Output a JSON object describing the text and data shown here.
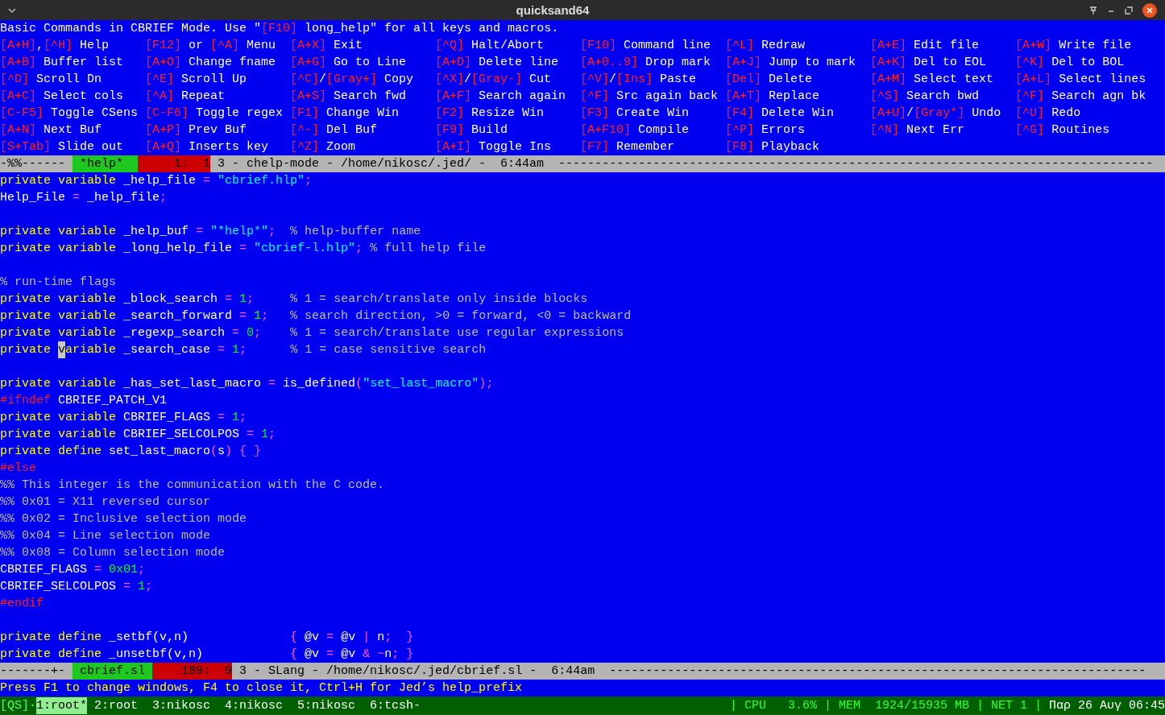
{
  "window": {
    "title": "quicksand64"
  },
  "help": {
    "header": [
      {
        "kind": "text",
        "text": "Basic Commands in CBRIEF Mode. Use \""
      },
      {
        "kind": "key",
        "text": "[F10]"
      },
      {
        "kind": "text",
        "text": " long_help\" for all keys and macros."
      }
    ],
    "rows": [
      [
        {
          "keys": [
            "[A+H]",
            "[^H]"
          ],
          "joiner": ",",
          "label": "Help"
        },
        {
          "keys": [
            "[F12]",
            "[^A]"
          ],
          "joiner": " or ",
          "label": "Menu"
        },
        {
          "keys": [
            "[A+X]"
          ],
          "label": "Exit"
        },
        {
          "keys": [
            "[^Q]"
          ],
          "label": "Halt/Abort"
        },
        {
          "keys": [
            "[F10]"
          ],
          "label": "Command line"
        },
        {
          "keys": [
            "[^L]"
          ],
          "label": "Redraw"
        },
        {
          "keys": [
            "[A+E]"
          ],
          "label": "Edit file"
        },
        {
          "keys": [
            "[A+W]"
          ],
          "label": "Write file"
        }
      ],
      [
        {
          "keys": [
            "[A+B]"
          ],
          "label": "Buffer list"
        },
        {
          "keys": [
            "[A+O]"
          ],
          "label": "Change fname"
        },
        {
          "keys": [
            "[A+G]"
          ],
          "label": "Go to Line"
        },
        {
          "keys": [
            "[A+D]"
          ],
          "label": "Delete line"
        },
        {
          "keys": [
            "[A+0..9]"
          ],
          "label": "Drop mark"
        },
        {
          "keys": [
            "[A+J]"
          ],
          "label": "Jump to mark"
        },
        {
          "keys": [
            "[A+K]"
          ],
          "label": "Del to EOL"
        },
        {
          "keys": [
            "[^K]"
          ],
          "label": "Del to BOL"
        }
      ],
      [
        {
          "keys": [
            "[^D]"
          ],
          "label": "Scroll Dn"
        },
        {
          "keys": [
            "[^E]"
          ],
          "label": "Scroll Up"
        },
        {
          "keys": [
            "[^C]",
            "[Gray+]"
          ],
          "joiner": "/",
          "label": "Copy"
        },
        {
          "keys": [
            "[^X]",
            "[Gray-]"
          ],
          "joiner": "/",
          "label": "Cut"
        },
        {
          "keys": [
            "[^V]",
            "[Ins]"
          ],
          "joiner": "/",
          "label": "Paste"
        },
        {
          "keys": [
            "[Del]"
          ],
          "label": "Delete"
        },
        {
          "keys": [
            "[A+M]"
          ],
          "label": "Select text"
        },
        {
          "keys": [
            "[A+L]"
          ],
          "label": "Select lines"
        }
      ],
      [
        {
          "keys": [
            "[A+C]"
          ],
          "label": "Select cols"
        },
        {
          "keys": [
            "[^A]"
          ],
          "label": "Repeat"
        },
        {
          "keys": [
            "[A+S]"
          ],
          "label": "Search fwd"
        },
        {
          "keys": [
            "[A+F]"
          ],
          "label": "Search again"
        },
        {
          "keys": [
            "[^F]"
          ],
          "label": "Src again back"
        },
        {
          "keys": [
            "[A+T]"
          ],
          "label": "Replace"
        },
        {
          "keys": [
            "[^S]"
          ],
          "label": "Search bwd"
        },
        {
          "keys": [
            "[^F]"
          ],
          "label": "Search agn bk"
        }
      ],
      [
        {
          "keys": [
            "[C-F5]"
          ],
          "label": "Toggle CSens"
        },
        {
          "keys": [
            "[C-F6]"
          ],
          "label": "Toggle regex"
        },
        {
          "keys": [
            "[F1]"
          ],
          "label": "Change Win"
        },
        {
          "keys": [
            "[F2]"
          ],
          "label": "Resize Win"
        },
        {
          "keys": [
            "[F3]"
          ],
          "label": "Create Win"
        },
        {
          "keys": [
            "[F4]"
          ],
          "label": "Delete Win"
        },
        {
          "keys": [
            "[A+U]",
            "[Gray*]"
          ],
          "joiner": "/",
          "label": "Undo"
        },
        {
          "keys": [
            "[^U]"
          ],
          "label": "Redo"
        }
      ],
      [
        {
          "keys": [
            "[A+N]"
          ],
          "label": "Next Buf"
        },
        {
          "keys": [
            "[A+P]"
          ],
          "label": "Prev Buf"
        },
        {
          "keys": [
            "[^-]"
          ],
          "label": "Del Buf"
        },
        {
          "keys": [
            "[F9]"
          ],
          "label": "Build"
        },
        {
          "keys": [
            "[A+F10]"
          ],
          "label": "Compile"
        },
        {
          "keys": [
            "[^P]"
          ],
          "label": "Errors"
        },
        {
          "keys": [
            "[^N]"
          ],
          "label": "Next Err"
        },
        {
          "keys": [
            "[^G]"
          ],
          "label": "Routines"
        }
      ],
      [
        {
          "keys": [
            "[S+Tab]"
          ],
          "label": "Slide out"
        },
        {
          "keys": [
            "[A+Q]"
          ],
          "label": "Inserts key"
        },
        {
          "keys": [
            "[^Z]"
          ],
          "label": "Zoom"
        },
        {
          "keys": [
            "[A+I]"
          ],
          "label": "Toggle Ins"
        },
        {
          "keys": [
            "[F7]"
          ],
          "label": "Remember"
        },
        {
          "keys": [
            "[F8]"
          ],
          "label": "Playback"
        }
      ]
    ]
  },
  "status_bar_top": [
    {
      "kind": "plain",
      "text": "-%%------ "
    },
    {
      "kind": "buffer",
      "text": " *help*  "
    },
    {
      "kind": "position",
      "text": "     1:  1"
    },
    {
      "kind": "fill",
      "text": " 3 - chelp-mode - /home/nikosc/.jed/ -  6:44am  ----------------------------------------------------------------------------------"
    }
  ],
  "code_lines": [
    {
      "kind": "code",
      "segments": [
        {
          "kind": "kw",
          "text": "private variable"
        },
        {
          "kind": "id",
          "text": " _help_file "
        },
        {
          "kind": "op",
          "text": "="
        },
        {
          "kind": "str",
          "text": " \"cbrief.hlp\""
        },
        {
          "kind": "op",
          "text": ";"
        }
      ]
    },
    {
      "kind": "code",
      "segments": [
        {
          "kind": "id",
          "text": "Help_File "
        },
        {
          "kind": "op",
          "text": "="
        },
        {
          "kind": "id",
          "text": " _help_file"
        },
        {
          "kind": "op",
          "text": ";"
        }
      ]
    },
    {
      "kind": "blank"
    },
    {
      "kind": "code",
      "segments": [
        {
          "kind": "kw",
          "text": "private variable"
        },
        {
          "kind": "id",
          "text": " _help_buf "
        },
        {
          "kind": "op",
          "text": "="
        },
        {
          "kind": "str",
          "text": " \"*help*\""
        },
        {
          "kind": "op",
          "text": ";"
        },
        {
          "kind": "com",
          "text": "  % help-buffer name"
        }
      ]
    },
    {
      "kind": "code",
      "segments": [
        {
          "kind": "kw",
          "text": "private variable"
        },
        {
          "kind": "id",
          "text": " _long_help_file "
        },
        {
          "kind": "op",
          "text": "="
        },
        {
          "kind": "str",
          "text": " \"cbrief-l.hlp\""
        },
        {
          "kind": "op",
          "text": ";"
        },
        {
          "kind": "com",
          "text": " % full help file"
        }
      ]
    },
    {
      "kind": "blank"
    },
    {
      "kind": "code",
      "segments": [
        {
          "kind": "com",
          "text": "% run-time flags"
        }
      ]
    },
    {
      "kind": "code",
      "segments": [
        {
          "kind": "kw",
          "text": "private variable"
        },
        {
          "kind": "id",
          "text": " _block_search "
        },
        {
          "kind": "op",
          "text": "="
        },
        {
          "kind": "num",
          "text": " 1"
        },
        {
          "kind": "op",
          "text": ";"
        },
        {
          "kind": "com",
          "text": "     % 1 = search/translate only inside blocks"
        }
      ]
    },
    {
      "kind": "code",
      "segments": [
        {
          "kind": "kw",
          "text": "private variable"
        },
        {
          "kind": "id",
          "text": " _search_forward "
        },
        {
          "kind": "op",
          "text": "="
        },
        {
          "kind": "num",
          "text": " 1"
        },
        {
          "kind": "op",
          "text": ";"
        },
        {
          "kind": "com",
          "text": "   % search direction, >0 = forward, <0 = backward"
        }
      ]
    },
    {
      "kind": "code",
      "segments": [
        {
          "kind": "kw",
          "text": "private variable"
        },
        {
          "kind": "id",
          "text": " _regexp_search "
        },
        {
          "kind": "op",
          "text": "="
        },
        {
          "kind": "num",
          "text": " 0"
        },
        {
          "kind": "op",
          "text": ";"
        },
        {
          "kind": "com",
          "text": "    % 1 = search/translate use regular expressions"
        }
      ]
    },
    {
      "kind": "code",
      "segments": [
        {
          "kind": "kw",
          "text": "private "
        },
        {
          "kind": "cursor",
          "text": "v"
        },
        {
          "kind": "kw",
          "text": "ariable"
        },
        {
          "kind": "id",
          "text": " _search_case "
        },
        {
          "kind": "op",
          "text": "="
        },
        {
          "kind": "num",
          "text": " 1"
        },
        {
          "kind": "op",
          "text": ";"
        },
        {
          "kind": "com",
          "text": "      % 1 = case sensitive search"
        }
      ]
    },
    {
      "kind": "blank"
    },
    {
      "kind": "code",
      "segments": [
        {
          "kind": "kw",
          "text": "private variable"
        },
        {
          "kind": "id",
          "text": " _has_set_last_macro "
        },
        {
          "kind": "op",
          "text": "="
        },
        {
          "kind": "id",
          "text": " is_defined"
        },
        {
          "kind": "op",
          "text": "("
        },
        {
          "kind": "str",
          "text": "\"set_last_macro\""
        },
        {
          "kind": "op",
          "text": ");"
        }
      ]
    },
    {
      "kind": "code",
      "segments": [
        {
          "kind": "pp",
          "text": "#ifndef"
        },
        {
          "kind": "id",
          "text": " CBRIEF_PATCH_V1"
        }
      ]
    },
    {
      "kind": "code",
      "segments": [
        {
          "kind": "kw",
          "text": "private variable"
        },
        {
          "kind": "id",
          "text": " CBRIEF_FLAGS "
        },
        {
          "kind": "op",
          "text": "="
        },
        {
          "kind": "num",
          "text": " 1"
        },
        {
          "kind": "op",
          "text": ";"
        }
      ]
    },
    {
      "kind": "code",
      "segments": [
        {
          "kind": "kw",
          "text": "private variable"
        },
        {
          "kind": "id",
          "text": " CBRIEF_SELCOLPOS "
        },
        {
          "kind": "op",
          "text": "="
        },
        {
          "kind": "num",
          "text": " 1"
        },
        {
          "kind": "op",
          "text": ";"
        }
      ]
    },
    {
      "kind": "code",
      "segments": [
        {
          "kind": "kw",
          "text": "private define"
        },
        {
          "kind": "id",
          "text": " set_last_macro"
        },
        {
          "kind": "op",
          "text": "("
        },
        {
          "kind": "id",
          "text": "s"
        },
        {
          "kind": "op",
          "text": ") { }"
        }
      ]
    },
    {
      "kind": "code",
      "segments": [
        {
          "kind": "pp",
          "text": "#else"
        }
      ]
    },
    {
      "kind": "code",
      "segments": [
        {
          "kind": "com",
          "text": "%% This integer is the communication with the C code."
        }
      ]
    },
    {
      "kind": "code",
      "segments": [
        {
          "kind": "com",
          "text": "%% 0x01 = X11 reversed cursor"
        }
      ]
    },
    {
      "kind": "code",
      "segments": [
        {
          "kind": "com",
          "text": "%% 0x02 = Inclusive selection mode"
        }
      ]
    },
    {
      "kind": "code",
      "segments": [
        {
          "kind": "com",
          "text": "%% 0x04 = Line selection mode"
        }
      ]
    },
    {
      "kind": "code",
      "segments": [
        {
          "kind": "com",
          "text": "%% 0x08 = Column selection mode"
        }
      ]
    },
    {
      "kind": "code",
      "segments": [
        {
          "kind": "id",
          "text": "CBRIEF_FLAGS "
        },
        {
          "kind": "op",
          "text": "="
        },
        {
          "kind": "num",
          "text": " 0x01"
        },
        {
          "kind": "op",
          "text": ";"
        }
      ]
    },
    {
      "kind": "code",
      "segments": [
        {
          "kind": "id",
          "text": "CBRIEF_SELCOLPOS "
        },
        {
          "kind": "op",
          "text": "="
        },
        {
          "kind": "num",
          "text": " 1"
        },
        {
          "kind": "op",
          "text": ";"
        }
      ]
    },
    {
      "kind": "code",
      "segments": [
        {
          "kind": "pp",
          "text": "#endif"
        }
      ]
    },
    {
      "kind": "blank"
    },
    {
      "kind": "code",
      "segments": [
        {
          "kind": "kw",
          "text": "private define"
        },
        {
          "kind": "id",
          "text": " _setbf(v,n)              "
        },
        {
          "kind": "op",
          "text": "{ "
        },
        {
          "kind": "id",
          "text": "@v "
        },
        {
          "kind": "op",
          "text": "= "
        },
        {
          "kind": "id",
          "text": "@v "
        },
        {
          "kind": "op",
          "text": "| "
        },
        {
          "kind": "id",
          "text": "n"
        },
        {
          "kind": "op",
          "text": ";  }"
        }
      ]
    },
    {
      "kind": "code",
      "segments": [
        {
          "kind": "kw",
          "text": "private define"
        },
        {
          "kind": "id",
          "text": " _unsetbf(v,n)            "
        },
        {
          "kind": "op",
          "text": "{ "
        },
        {
          "kind": "id",
          "text": "@v "
        },
        {
          "kind": "op",
          "text": "= "
        },
        {
          "kind": "id",
          "text": "@v "
        },
        {
          "kind": "op",
          "text": "& ~"
        },
        {
          "kind": "id",
          "text": "n"
        },
        {
          "kind": "op",
          "text": "; }"
        }
      ]
    }
  ],
  "status_bar_bottom": [
    {
      "kind": "plain",
      "text": "-------+- "
    },
    {
      "kind": "buffer",
      "text": " cbrief.sl "
    },
    {
      "kind": "position",
      "text": "    189:  9"
    },
    {
      "kind": "fill",
      "text": " 3 - SLang - /home/nikosc/.jed/cbrief.sl -  6:44am  --------------------------------------------------------------------------"
    }
  ],
  "message": "Press F1 to change windows, F4 to close it, Ctrl+H for Jed’s help_prefix",
  "tmux": {
    "session": "[QS]",
    "separator": "·",
    "windows": [
      {
        "label": "1:root*",
        "selected": true
      },
      {
        "label": "2:root",
        "selected": false
      },
      {
        "label": "3:nikosc",
        "selected": false
      },
      {
        "label": "4:nikosc",
        "selected": false
      },
      {
        "label": "5:nikosc",
        "selected": false
      },
      {
        "label": "6:tcsh-",
        "selected": false
      }
    ],
    "stats": "| CPU   3.6% | MEM  1924/15935 MB | NET 1 |",
    "clock": "Παρ 26 Αυγ 06:45"
  }
}
